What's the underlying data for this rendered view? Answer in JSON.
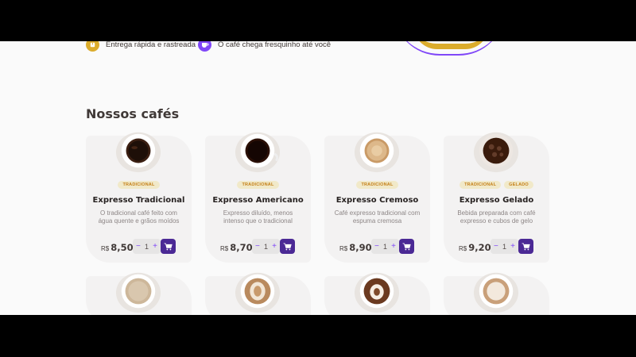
{
  "hero": {
    "features": [
      {
        "label": "Entrega rápida e rastreada",
        "icon": "package-icon",
        "color": "#DBAC2C"
      },
      {
        "label": "O café chega fresquinho até você",
        "icon": "coffee-cup-icon",
        "color": "#8047F8"
      }
    ]
  },
  "catalog": {
    "title": "Nossos cafés",
    "currency": "R$",
    "products": [
      {
        "name": "Expresso Tradicional",
        "description": "O tradicional café feito com água quente e grãos moídos",
        "tags": [
          "TRADICIONAL"
        ],
        "price": "8,50",
        "quantity": "1",
        "cup": "traditional"
      },
      {
        "name": "Expresso Americano",
        "description": "Expresso diluído, menos intenso que o tradicional",
        "tags": [
          "TRADICIONAL"
        ],
        "price": "8,70",
        "quantity": "1",
        "cup": "american"
      },
      {
        "name": "Expresso Cremoso",
        "description": "Café expresso tradicional com espuma cremosa",
        "tags": [
          "TRADICIONAL"
        ],
        "price": "8,90",
        "quantity": "1",
        "cup": "creamy"
      },
      {
        "name": "Expresso Gelado",
        "description": "Bebida preparada com café expresso e cubos de gelo",
        "tags": [
          "TRADICIONAL",
          "GELADO"
        ],
        "price": "9,20",
        "quantity": "1",
        "cup": "iced"
      }
    ],
    "colors": {
      "primary": "#4B2995",
      "accent": "#8047F8",
      "yellow": "#DBAC2C",
      "tag_bg": "#F1E9C9",
      "tag_text": "#C47F17"
    }
  }
}
